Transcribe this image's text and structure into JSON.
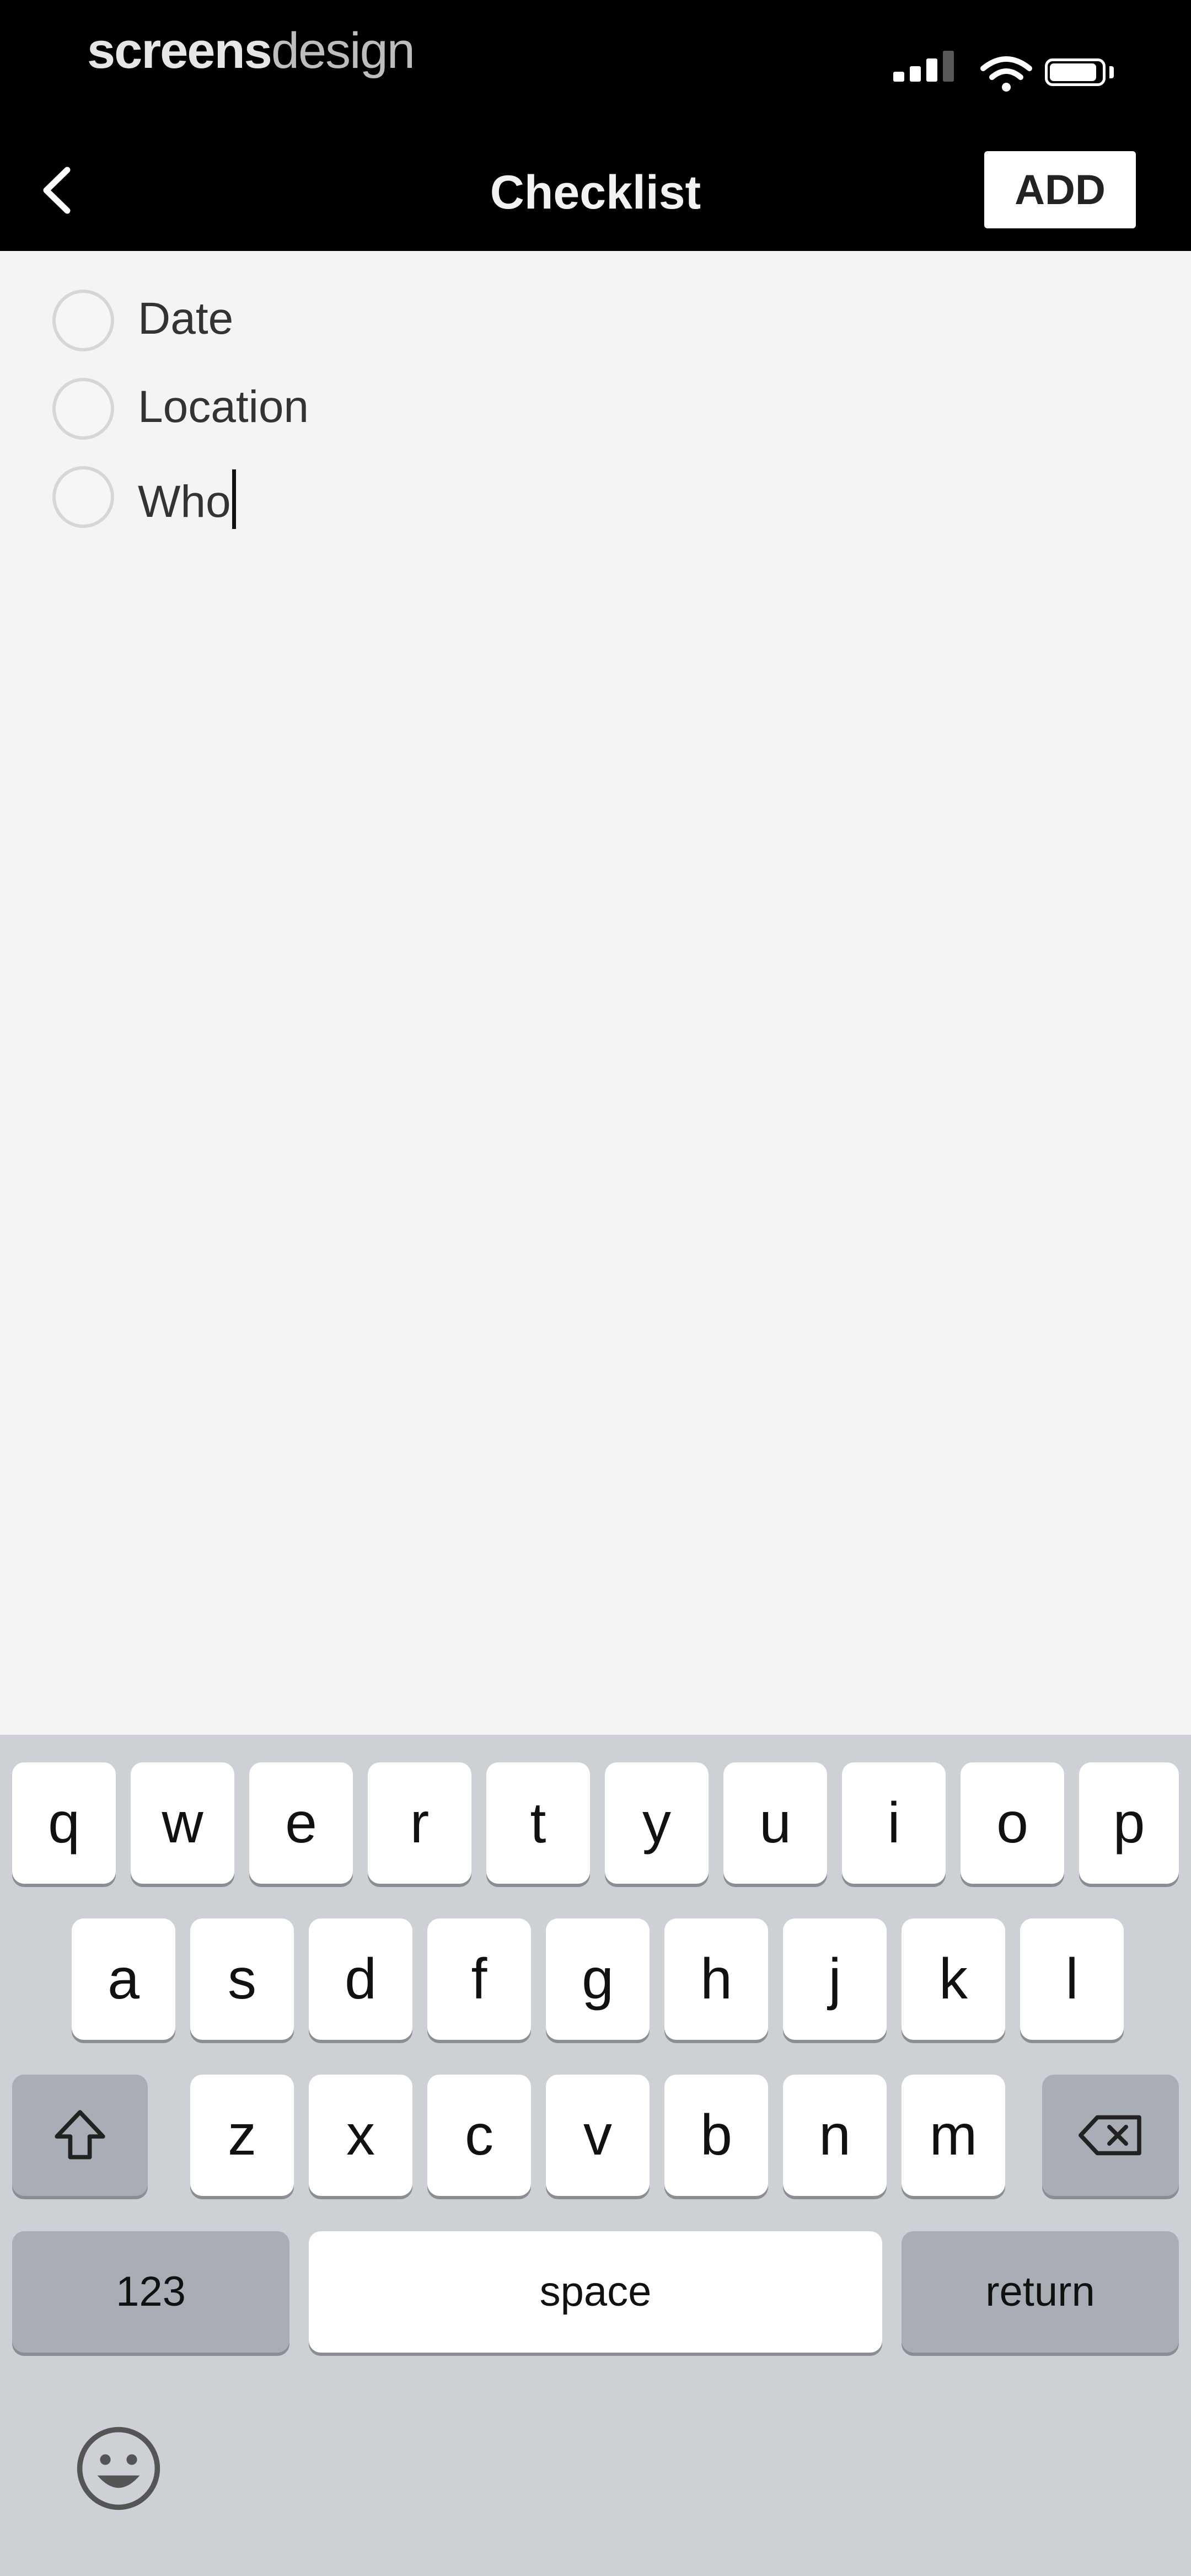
{
  "status_bar": {
    "watermark_bold": "screens",
    "watermark_thin": "design",
    "icons": [
      "signal-icon",
      "wifi-icon",
      "battery-icon"
    ]
  },
  "nav": {
    "back_icon": "chevron-left-icon",
    "title": "Checklist",
    "add_label": "ADD"
  },
  "checklist": {
    "items": [
      {
        "label": "Date",
        "checked": false
      },
      {
        "label": "Location",
        "checked": false
      },
      {
        "label": "Who",
        "checked": false,
        "editing": true
      }
    ]
  },
  "keyboard": {
    "row1": [
      "q",
      "w",
      "e",
      "r",
      "t",
      "y",
      "u",
      "i",
      "o",
      "p"
    ],
    "row2": [
      "a",
      "s",
      "d",
      "f",
      "g",
      "h",
      "j",
      "k",
      "l"
    ],
    "row3": [
      "z",
      "x",
      "c",
      "v",
      "b",
      "n",
      "m"
    ],
    "shift_icon": "shift-icon",
    "delete_icon": "backspace-icon",
    "numbers_label": "123",
    "space_label": "space",
    "return_label": "return",
    "emoji_icon": "emoji-icon"
  },
  "colors": {
    "nav_background": "#000000",
    "content_background": "#f4f4f4",
    "keyboard_background": "#cdd0d5",
    "function_key": "#a9aeb6"
  }
}
